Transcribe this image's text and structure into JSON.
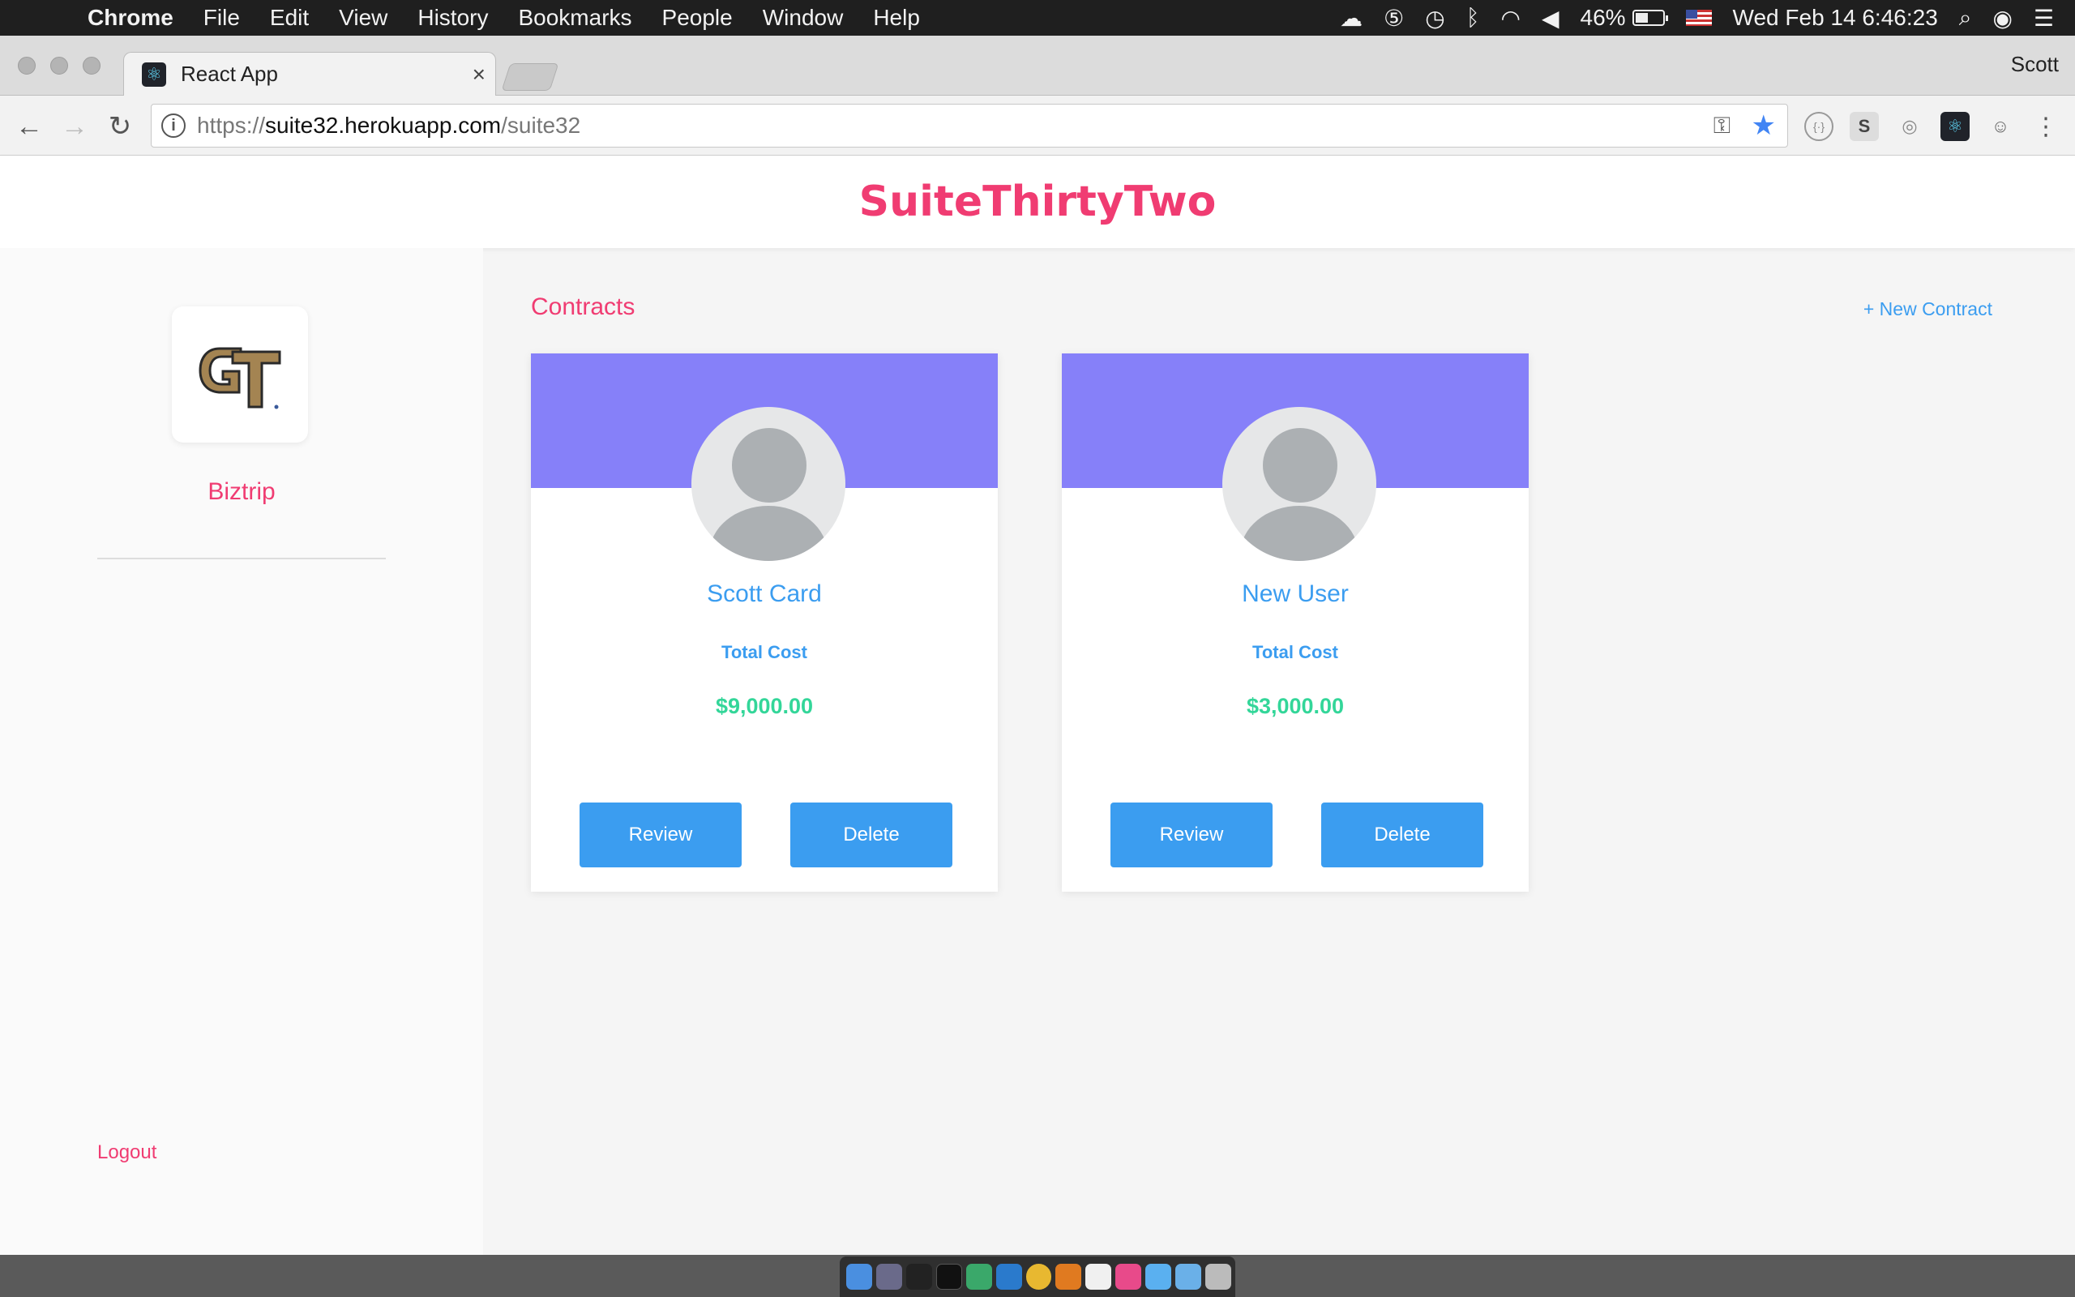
{
  "menubar": {
    "apple": "",
    "items": [
      "Chrome",
      "File",
      "Edit",
      "View",
      "History",
      "Bookmarks",
      "People",
      "Window",
      "Help"
    ],
    "battery": "46%",
    "datetime": "Wed Feb 14  6:46:23"
  },
  "browser": {
    "tab_title": "React App",
    "tab_close": "×",
    "profile": "Scott",
    "url_scheme": "https://",
    "url_host": "suite32.herokuapp.com",
    "url_path": "/suite32"
  },
  "app": {
    "brand": "SuiteThirtyTwo",
    "org_name": "Biztrip",
    "logout": "Logout",
    "section_title": "Contracts",
    "new_contract": "+ New Contract",
    "cards": [
      {
        "name": "Scott Card",
        "cost_label": "Total Cost",
        "cost": "$9,000.00",
        "review": "Review",
        "delete": "Delete"
      },
      {
        "name": "New User",
        "cost_label": "Total Cost",
        "cost": "$3,000.00",
        "review": "Review",
        "delete": "Delete"
      }
    ]
  },
  "colors": {
    "brand": "#f03c72",
    "accent": "#3b9df0",
    "banner": "#8680f9",
    "money": "#33d699"
  },
  "dock_icons": [
    "finder-icon",
    "launchpad-icon",
    "terminal-icon",
    "iterm-icon",
    "safari-icon",
    "vscode-icon",
    "chrome-icon",
    "sublime-icon",
    "photos-icon",
    "itunes-icon",
    "messages-icon",
    "folder-icon",
    "trash-icon"
  ]
}
